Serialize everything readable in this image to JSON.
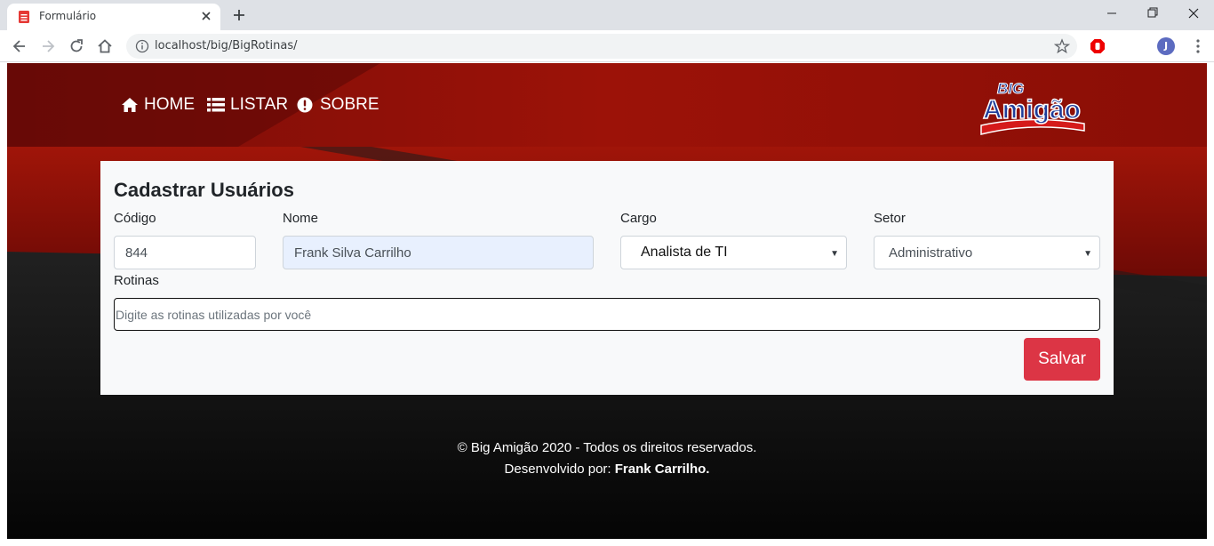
{
  "browser": {
    "tab_title": "Formulário",
    "url": "localhost/big/BigRotinas/",
    "profile_initial": "J"
  },
  "navbar": {
    "items": [
      {
        "label": "HOME",
        "icon": "home-icon"
      },
      {
        "label": "LISTAR",
        "icon": "list-icon"
      },
      {
        "label": "SOBRE",
        "icon": "exclamation-circle-icon"
      }
    ],
    "logo": {
      "line1": "BIG",
      "line2": "Amigão"
    }
  },
  "form": {
    "title": "Cadastrar Usuários",
    "codigo": {
      "label": "Código",
      "value": "844"
    },
    "nome": {
      "label": "Nome",
      "value": "Frank Silva Carrilho"
    },
    "cargo": {
      "label": "Cargo",
      "value": "Analista de TI"
    },
    "setor": {
      "label": "Setor",
      "value": "Administrativo"
    },
    "rotinas": {
      "label": "Rotinas",
      "placeholder": "Digite as rotinas utilizadas por você"
    },
    "save_label": "Salvar"
  },
  "footer": {
    "line1": "© Big Amigão 2020 - Todos os direitos reservados.",
    "line2_prefix": "Desenvolvido por:",
    "line2_author": "Frank Carrilho."
  },
  "colors": {
    "primary_red": "#dc3545",
    "header_red": "#8b0a05",
    "card_bg": "#f8f9fa"
  }
}
